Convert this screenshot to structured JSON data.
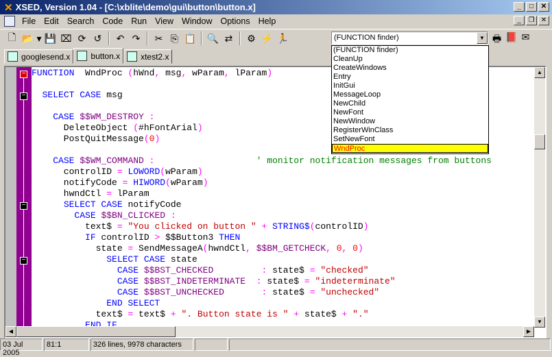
{
  "title": "XSED, Version 1.04 - [C:\\xblite\\demo\\gui\\button\\button.x]",
  "menu": [
    "File",
    "Edit",
    "Search",
    "Code",
    "Run",
    "View",
    "Window",
    "Options",
    "Help"
  ],
  "toolbar": [
    "new",
    "open",
    "dropdown",
    "save",
    "close",
    "reload",
    "refresh",
    "undo",
    "redo",
    "cut",
    "copy",
    "paste",
    "find",
    "replace",
    "compile",
    "build",
    "run"
  ],
  "finder": {
    "value": "(FUNCTION finder)",
    "items": [
      "(FUNCTION finder)",
      "CleanUp",
      "CreateWindows",
      "Entry",
      "InitGui",
      "MessageLoop",
      "NewChild",
      "NewFont",
      "NewWindow",
      "RegisterWinClass",
      "SetNewFont",
      "WndProc"
    ],
    "selected": "WndProc"
  },
  "tabs": [
    "googlesend.x",
    "button.x",
    "xtest2.x"
  ],
  "active_tab": "button.x",
  "code": [
    [
      [
        "FUNCTION",
        "k"
      ],
      [
        "  WndProc ",
        ""
      ],
      [
        "(",
        "o"
      ],
      [
        "hWnd",
        ""
      ],
      [
        ", ",
        "o"
      ],
      [
        "msg",
        ""
      ],
      [
        ", ",
        "o"
      ],
      [
        "wParam",
        ""
      ],
      [
        ", ",
        "o"
      ],
      [
        "lParam",
        ""
      ],
      [
        ")",
        "o"
      ]
    ],
    [],
    [
      [
        "  ",
        ""
      ],
      [
        "SELECT CASE",
        "k"
      ],
      [
        " msg",
        ""
      ]
    ],
    [],
    [
      [
        "    ",
        ""
      ],
      [
        "CASE",
        "k"
      ],
      [
        " $$WM_DESTROY ",
        "c"
      ],
      [
        ":",
        "o"
      ]
    ],
    [
      [
        "      DeleteObject ",
        ""
      ],
      [
        "(",
        "o"
      ],
      [
        "#hFontArial",
        ""
      ],
      [
        ")",
        "o"
      ]
    ],
    [
      [
        "      PostQuitMessage",
        ""
      ],
      [
        "(",
        "o"
      ],
      [
        "0",
        "n"
      ],
      [
        ")",
        "o"
      ]
    ],
    [],
    [
      [
        "    ",
        ""
      ],
      [
        "CASE",
        "k"
      ],
      [
        " $$WM_COMMAND ",
        "c"
      ],
      [
        ":",
        "o"
      ],
      [
        "                   ",
        ""
      ],
      [
        "' monitor notification messages from buttons",
        "g"
      ]
    ],
    [
      [
        "      controlID ",
        ""
      ],
      [
        "=",
        "o"
      ],
      [
        " ",
        ""
      ],
      [
        "LOWORD",
        "k"
      ],
      [
        "(",
        "o"
      ],
      [
        "wParam",
        ""
      ],
      [
        ")",
        "o"
      ]
    ],
    [
      [
        "      notifyCode ",
        ""
      ],
      [
        "=",
        "o"
      ],
      [
        " ",
        ""
      ],
      [
        "HIWORD",
        "k"
      ],
      [
        "(",
        "o"
      ],
      [
        "wParam",
        ""
      ],
      [
        ")",
        "o"
      ]
    ],
    [
      [
        "      hwndCtl ",
        ""
      ],
      [
        "=",
        "o"
      ],
      [
        " lParam",
        ""
      ]
    ],
    [
      [
        "      ",
        ""
      ],
      [
        "SELECT CASE",
        "k"
      ],
      [
        " notifyCode",
        ""
      ]
    ],
    [
      [
        "        ",
        ""
      ],
      [
        "CASE",
        "k"
      ],
      [
        " $$BN_CLICKED ",
        "c"
      ],
      [
        ":",
        "o"
      ]
    ],
    [
      [
        "          text$ ",
        ""
      ],
      [
        "=",
        "o"
      ],
      [
        " ",
        ""
      ],
      [
        "\"You clicked on button \"",
        "s"
      ],
      [
        " + ",
        "o"
      ],
      [
        "STRING$",
        "k"
      ],
      [
        "(",
        "o"
      ],
      [
        "controlID",
        ""
      ],
      [
        ")",
        "o"
      ]
    ],
    [
      [
        "          ",
        ""
      ],
      [
        "IF",
        "k"
      ],
      [
        " controlID ",
        ""
      ],
      [
        ">",
        "o"
      ],
      [
        " $$Button3 ",
        ""
      ],
      [
        "THEN",
        "k"
      ]
    ],
    [
      [
        "            state ",
        ""
      ],
      [
        "=",
        "o"
      ],
      [
        " SendMessageA",
        ""
      ],
      [
        "(",
        "o"
      ],
      [
        "hwndCtl",
        ""
      ],
      [
        ", ",
        "o"
      ],
      [
        "$$BM_GETCHECK",
        "c"
      ],
      [
        ", ",
        "o"
      ],
      [
        "0",
        "n"
      ],
      [
        ", ",
        "o"
      ],
      [
        "0",
        "n"
      ],
      [
        ")",
        "o"
      ]
    ],
    [
      [
        "              ",
        ""
      ],
      [
        "SELECT CASE",
        "k"
      ],
      [
        " state",
        ""
      ]
    ],
    [
      [
        "                ",
        ""
      ],
      [
        "CASE",
        "k"
      ],
      [
        " $$BST_CHECKED         ",
        "c"
      ],
      [
        ":",
        "o"
      ],
      [
        " state$ ",
        ""
      ],
      [
        "=",
        "o"
      ],
      [
        " ",
        ""
      ],
      [
        "\"checked\"",
        "s"
      ]
    ],
    [
      [
        "                ",
        ""
      ],
      [
        "CASE",
        "k"
      ],
      [
        " $$BST_INDETERMINATE  ",
        "c"
      ],
      [
        ":",
        "o"
      ],
      [
        " state$ ",
        ""
      ],
      [
        "=",
        "o"
      ],
      [
        " ",
        ""
      ],
      [
        "\"indeterminate\"",
        "s"
      ]
    ],
    [
      [
        "                ",
        ""
      ],
      [
        "CASE",
        "k"
      ],
      [
        " $$BST_UNCHECKED       ",
        "c"
      ],
      [
        ":",
        "o"
      ],
      [
        " state$ ",
        ""
      ],
      [
        "=",
        "o"
      ],
      [
        " ",
        ""
      ],
      [
        "\"unchecked\"",
        "s"
      ]
    ],
    [
      [
        "              ",
        ""
      ],
      [
        "END SELECT",
        "k"
      ]
    ],
    [
      [
        "            text$ ",
        ""
      ],
      [
        "=",
        "o"
      ],
      [
        " text$ ",
        ""
      ],
      [
        "+",
        "o"
      ],
      [
        " ",
        ""
      ],
      [
        "\". Button state is \"",
        "s"
      ],
      [
        " + ",
        "o"
      ],
      [
        "state$ ",
        ""
      ],
      [
        "+",
        "o"
      ],
      [
        " ",
        ""
      ],
      [
        "\".\"",
        "s"
      ]
    ],
    [
      [
        "          ",
        ""
      ],
      [
        "END IF",
        "k"
      ]
    ]
  ],
  "status": {
    "date": "03 Jul 2005",
    "position": "81:1",
    "info": "326 lines, 9978 characters"
  }
}
